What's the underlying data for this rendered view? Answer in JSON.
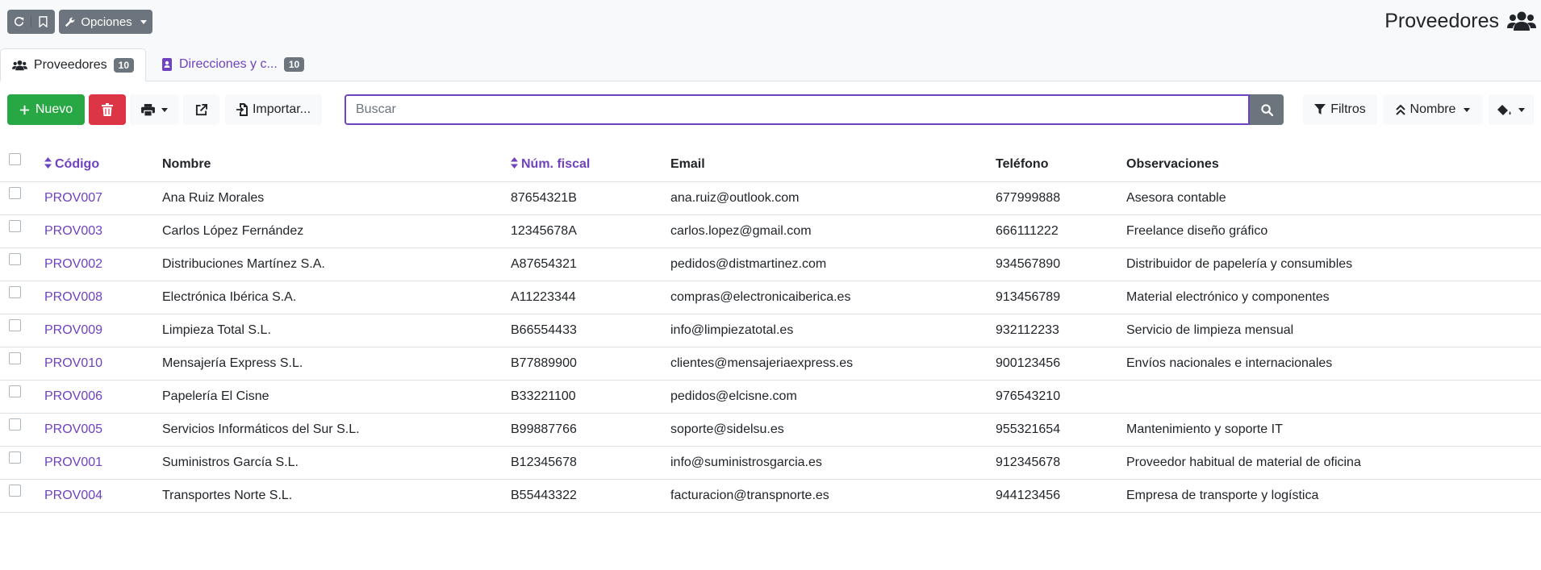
{
  "header": {
    "options_label": "Opciones",
    "title": "Proveedores",
    "icons": [
      "refresh-icon",
      "bookmark-icon",
      "wrench-icon",
      "users-icon"
    ]
  },
  "tabs": [
    {
      "label": "Proveedores",
      "count": "10",
      "icon": "users-icon",
      "active": true
    },
    {
      "label": "Direcciones y c...",
      "count": "10",
      "icon": "address-book-icon",
      "active": false
    }
  ],
  "toolbar": {
    "new_label": "Nuevo",
    "import_label": "Importar...",
    "search_placeholder": "Buscar",
    "filters_label": "Filtros",
    "order_label": "Nombre"
  },
  "table": {
    "columns": [
      "Código",
      "Nombre",
      "Núm. fiscal",
      "Email",
      "Teléfono",
      "Observaciones"
    ],
    "rows": [
      {
        "code": "PROV007",
        "name": "Ana Ruiz Morales",
        "tax_id": "87654321B",
        "email": "ana.ruiz@outlook.com",
        "phone": "677999888",
        "notes": "Asesora contable"
      },
      {
        "code": "PROV003",
        "name": "Carlos López Fernández",
        "tax_id": "12345678A",
        "email": "carlos.lopez@gmail.com",
        "phone": "666111222",
        "notes": "Freelance diseño gráfico"
      },
      {
        "code": "PROV002",
        "name": "Distribuciones Martínez S.A.",
        "tax_id": "A87654321",
        "email": "pedidos@distmartinez.com",
        "phone": "934567890",
        "notes": "Distribuidor de papelería y consumibles"
      },
      {
        "code": "PROV008",
        "name": "Electrónica Ibérica S.A.",
        "tax_id": "A11223344",
        "email": "compras@electronicaiberica.es",
        "phone": "913456789",
        "notes": "Material electrónico y componentes"
      },
      {
        "code": "PROV009",
        "name": "Limpieza Total S.L.",
        "tax_id": "B66554433",
        "email": "info@limpiezatotal.es",
        "phone": "932112233",
        "notes": "Servicio de limpieza mensual"
      },
      {
        "code": "PROV010",
        "name": "Mensajería Express S.L.",
        "tax_id": "B77889900",
        "email": "clientes@mensajeriaexpress.es",
        "phone": "900123456",
        "notes": "Envíos nacionales e internacionales"
      },
      {
        "code": "PROV006",
        "name": "Papelería El Cisne",
        "tax_id": "B33221100",
        "email": "pedidos@elcisne.com",
        "phone": "976543210",
        "notes": ""
      },
      {
        "code": "PROV005",
        "name": "Servicios Informáticos del Sur S.L.",
        "tax_id": "B99887766",
        "email": "soporte@sidelsu.es",
        "phone": "955321654",
        "notes": "Mantenimiento y soporte IT"
      },
      {
        "code": "PROV001",
        "name": "Suministros García S.L.",
        "tax_id": "B12345678",
        "email": "info@suministrosgarcia.es",
        "phone": "912345678",
        "notes": "Proveedor habitual de material de oficina"
      },
      {
        "code": "PROV004",
        "name": "Transportes Norte S.L.",
        "tax_id": "B55443322",
        "email": "facturacion@transpnorte.es",
        "phone": "944123456",
        "notes": "Empresa de transporte y logística"
      }
    ]
  },
  "colors": {
    "accent": "#6f42c1",
    "success": "#28a745",
    "danger": "#dc3545",
    "secondary": "#6c757d"
  }
}
